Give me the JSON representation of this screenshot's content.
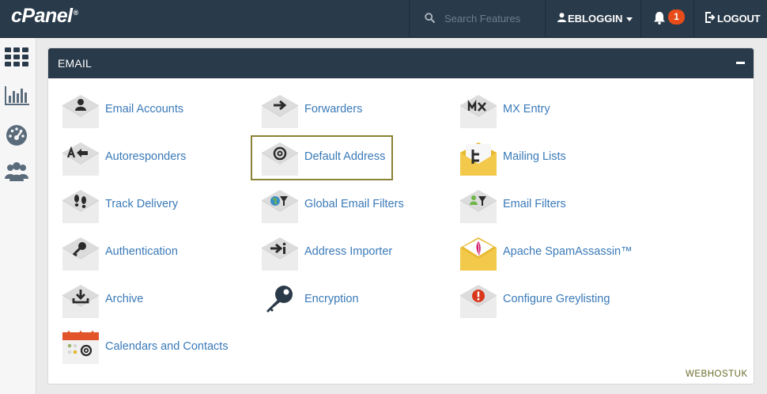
{
  "header": {
    "brand": "cPanel",
    "brand_mark": "®",
    "search_placeholder": "Search Features",
    "username": "EBLOGGIN",
    "notification_count": "1",
    "logout_label": "LOGOUT"
  },
  "rail": {
    "icons": [
      "grid-icon",
      "stats-icon",
      "dashboard-icon",
      "users-icon"
    ]
  },
  "section": {
    "title": "EMAIL",
    "items": [
      {
        "label": "Email Accounts",
        "icon": "email-accounts-icon"
      },
      {
        "label": "Forwarders",
        "icon": "forwarders-icon"
      },
      {
        "label": "MX Entry",
        "icon": "mx-entry-icon"
      },
      {
        "label": "Autoresponders",
        "icon": "autoresponders-icon"
      },
      {
        "label": "Default Address",
        "icon": "default-address-icon",
        "selected": true
      },
      {
        "label": "Mailing Lists",
        "icon": "mailing-lists-icon"
      },
      {
        "label": "Track Delivery",
        "icon": "track-delivery-icon"
      },
      {
        "label": "Global Email Filters",
        "icon": "global-filters-icon"
      },
      {
        "label": "Email Filters",
        "icon": "email-filters-icon"
      },
      {
        "label": "Authentication",
        "icon": "authentication-icon"
      },
      {
        "label": "Address Importer",
        "icon": "address-importer-icon"
      },
      {
        "label": "Apache SpamAssassin™",
        "icon": "spamassassin-icon"
      },
      {
        "label": "Archive",
        "icon": "archive-icon"
      },
      {
        "label": "Encryption",
        "icon": "encryption-icon"
      },
      {
        "label": "Configure Greylisting",
        "icon": "greylisting-icon"
      },
      {
        "label": "Calendars and Contacts",
        "icon": "calendars-icon"
      }
    ]
  },
  "watermark": "WEBHOSTUK",
  "colors": {
    "topbar": "#293a4a",
    "link": "#3a7ab8",
    "badge": "#e84c1a",
    "selected_outline": "#8a8234"
  }
}
